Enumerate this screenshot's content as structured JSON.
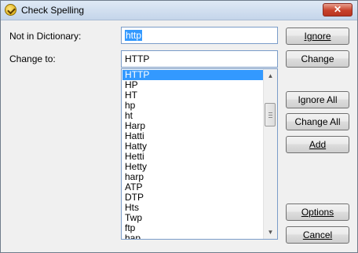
{
  "window": {
    "title": "Check Spelling",
    "close_glyph": "✕"
  },
  "labels": {
    "not_in_dictionary": "Not in Dictionary:",
    "change_to": "Change to:"
  },
  "fields": {
    "not_in_dictionary_value": "http",
    "change_to_value": "HTTP"
  },
  "suggestions": [
    "HTTP",
    "HP",
    "HT",
    "hp",
    "ht",
    "Harp",
    "Hatti",
    "Hatty",
    "Hetti",
    "Hetty",
    "harp",
    "ATP",
    "DTP",
    "Hts",
    "Twp",
    "ftp",
    "hap"
  ],
  "buttons": {
    "ignore": "Ignore",
    "change": "Change",
    "ignore_all": "Ignore All",
    "change_all": "Change All",
    "add": "Add",
    "options": "Options",
    "cancel": "Cancel"
  },
  "scrollbar": {
    "up_glyph": "▲",
    "down_glyph": "▼"
  }
}
